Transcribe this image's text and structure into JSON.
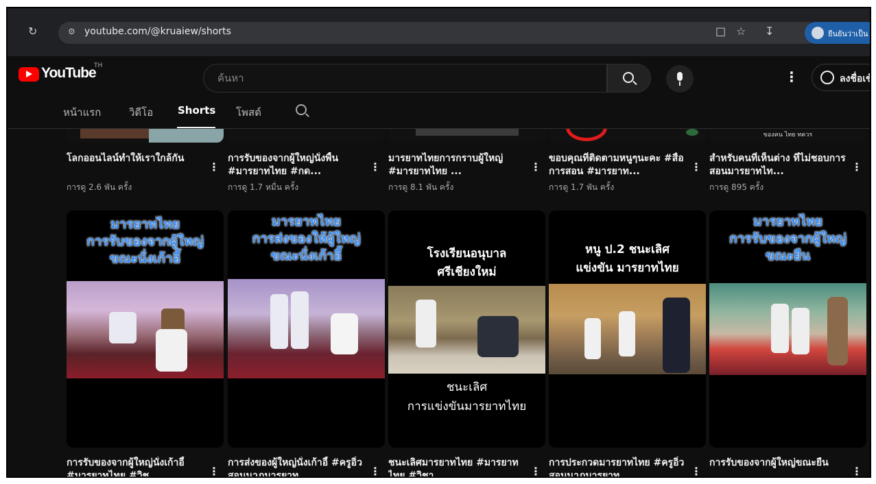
{
  "browser": {
    "url": "youtube.com/@kruaiew/shorts",
    "profile_label": "ยืนยันว่าเป็น"
  },
  "header": {
    "logo_text": "YouTube",
    "region": "TH",
    "search_placeholder": "ค้นหา",
    "signin_label": "ลงชื่อเข้"
  },
  "tabs": [
    {
      "label": "หน้าแรก"
    },
    {
      "label": "วิดีโอ"
    },
    {
      "label": "Shorts"
    },
    {
      "label": "โพสต์"
    }
  ],
  "row1": [
    {
      "title": "โลกออนไลน์ทำให้เราใกล้กัน",
      "views": "การดู 2.6 พัน ครั้ง"
    },
    {
      "title": "การรับของจากผู้ใหญ่นั่งพื้น #มารยาทไทย #กด...",
      "views": "การดู 1.7 หมื่น ครั้ง"
    },
    {
      "title": "มารยาทไทยการกราบผู้ใหญ่ #มารยาทไทย ...",
      "views": "การดู 8.1 พัน ครั้ง"
    },
    {
      "title": "ขอบคุณที่ติดตามหนูๆนะคะ #สื่อการสอน #มารยาท...",
      "views": "การดู 1.7 พัน ครั้ง"
    },
    {
      "title": "สำหรับคนที่เห็นต่าง ที่ไม่ชอบการสอนมารยาทไท...",
      "views": "การดู 895 ครั้ง",
      "strip_text": "ของคน ไทย ทควร"
    }
  ],
  "row2": [
    {
      "caption_top": [
        "มารยาทไทย",
        "การรับของจากผู้ใหญ่",
        "ขณะนั่งเก้าอี้"
      ],
      "title": "การรับของจากผู้ใหญ่นั่งเก้าอี้ #มารยาทไทย #วิช..."
    },
    {
      "caption_top": [
        "มารยาทไทย",
        "การส่งของให้ผู้ใหญ่",
        "ขณะนั่งเก้าอี้"
      ],
      "title": "การส่งของผู้ใหญ่นั่งเก้าอี้ #ครูอิ๋วสอนนาฏมารยาท..."
    },
    {
      "caption_top": [
        "โรงเรียนอนุบาล",
        "ศรีเชียงใหม่"
      ],
      "caption_bottom": [
        "ชนะเลิศ",
        "การแข่งขันมารยาทไทย"
      ],
      "title": "ชนะเลิศมารยาทไทย #มารยาทไทย #วิชา..."
    },
    {
      "caption_top": [
        "หนู ป.2 ชนะเลิศ",
        "แข่งขัน มารยาทไทย"
      ],
      "title": "การประกวดมารยาทไทย #ครูอิ๋วสอนนาฏมารยาท..."
    },
    {
      "caption_top": [
        "มารยาทไทย",
        "การรับของจากผู้ใหญ่",
        "ขณะยืน"
      ],
      "title": "การรับของจากผู้ใหญ่ขณะยืน"
    }
  ]
}
